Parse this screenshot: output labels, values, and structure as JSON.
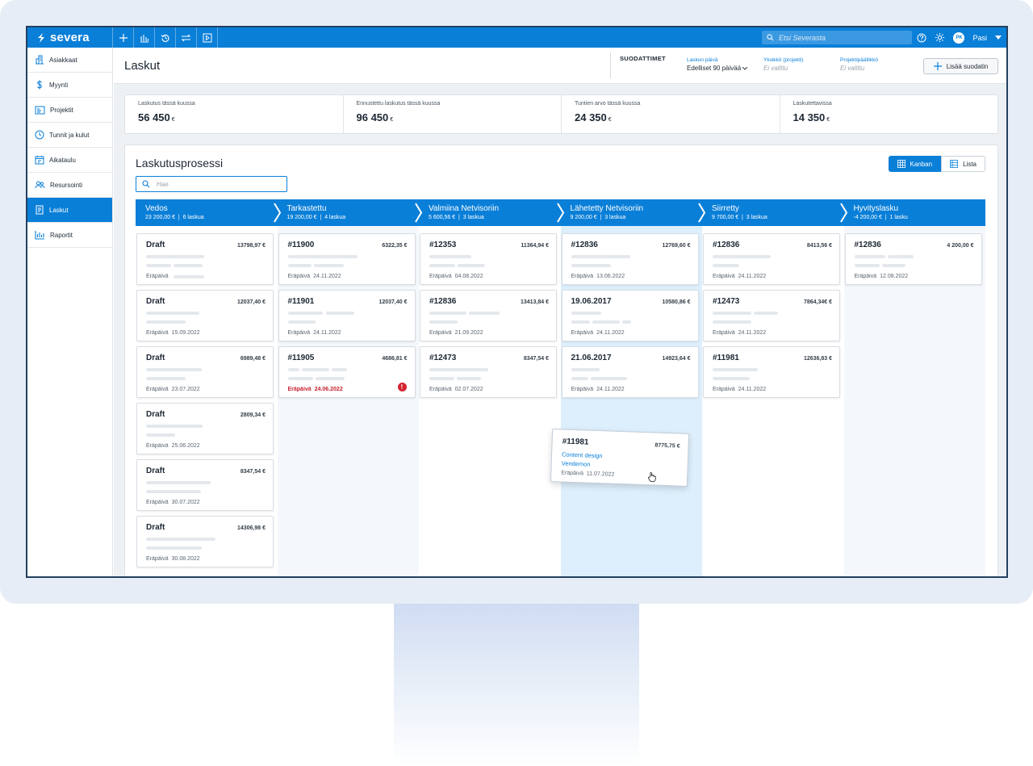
{
  "app": {
    "logo": "severa"
  },
  "topbar": {
    "icons": [
      "plus-icon",
      "bar-chart-icon",
      "history-icon",
      "swap-icon",
      "play-icon"
    ],
    "search_placeholder": "Etsi Severasta",
    "user_initials": "PK",
    "user_name": "Pasi"
  },
  "sidebar": {
    "items": [
      {
        "label": "Asiakkaat",
        "icon": "building-icon"
      },
      {
        "label": "Myynti",
        "icon": "dollar-icon"
      },
      {
        "label": "Projektit",
        "icon": "folder-icon"
      },
      {
        "label": "Tunnit ja kulut",
        "icon": "clock-icon"
      },
      {
        "label": "Aikataulu",
        "icon": "calendar-icon"
      },
      {
        "label": "Resursointi",
        "icon": "people-icon"
      },
      {
        "label": "Laskut",
        "icon": "invoice-icon",
        "active": true
      },
      {
        "label": "Raportit",
        "icon": "report-icon"
      }
    ]
  },
  "header": {
    "title": "Laskut",
    "filters_title": "SUODATTIMET",
    "filters": [
      {
        "label": "Laskun päivä",
        "value": "Edelliset 90 päivää"
      },
      {
        "label": "Yksikkö (projekti)",
        "value": "Ei valittu"
      },
      {
        "label": "Projektipäällikkö",
        "value": "Ei valittu"
      }
    ],
    "add_filter": "Lisää suodatin"
  },
  "stats": [
    {
      "label": "Laskutus tässä kuussa",
      "value": "56 450",
      "currency": "€"
    },
    {
      "label": "Ennustettu laskutus tässä kuussa",
      "value": "96 450",
      "currency": "€"
    },
    {
      "label": "Tuntien arvo tässä kuussa",
      "value": "24 350",
      "currency": "€"
    },
    {
      "label": "Laskutettavissa",
      "value": "14 350",
      "currency": "€"
    }
  ],
  "process": {
    "title": "Laskutusprosessi",
    "search_placeholder": "Hae",
    "view_kanban": "Kanban",
    "view_list": "Lista"
  },
  "due_label": "Eräpäivä",
  "columns": [
    {
      "name": "Vedos",
      "total": "23 200,00 €",
      "count": "6 laskua",
      "cards": [
        {
          "title": "Draft",
          "amount": "13798,97 €",
          "due": ""
        },
        {
          "title": "Draft",
          "amount": "12037,40 €",
          "due": "15.09.2022"
        },
        {
          "title": "Draft",
          "amount": "6989,48 €",
          "due": "23.07.2022"
        },
        {
          "title": "Draft",
          "amount": "2809,34 €",
          "due": "25.06.2022"
        },
        {
          "title": "Draft",
          "amount": "8347,54 €",
          "due": "30.07.2022"
        },
        {
          "title": "Draft",
          "amount": "14306,98 €",
          "due": "30.08.2022"
        }
      ]
    },
    {
      "name": "Tarkastettu",
      "total": "19 200,00 €",
      "count": "4 laskua",
      "cards": [
        {
          "title": "#11900",
          "amount": "6322,35 €",
          "due": "24.11.2022"
        },
        {
          "title": "#11901",
          "amount": "12037,40 €",
          "due": "24.11.2022"
        },
        {
          "title": "#11905",
          "amount": "4686,81 €",
          "due": "24.06.2022",
          "overdue": true
        }
      ]
    },
    {
      "name": "Valmiina Netvisoriin",
      "total": "5 600,56 €",
      "count": "3 laskua",
      "cards": [
        {
          "title": "#12353",
          "amount": "11364,94 €",
          "due": "04.08.2022"
        },
        {
          "title": "#12836",
          "amount": "13413,84 €",
          "due": "21.09.2022"
        },
        {
          "title": "#12473",
          "amount": "8347,54 €",
          "due": "02.07.2022"
        }
      ]
    },
    {
      "name": "Lähetetty Netvisoriin",
      "total": "9 200,00 €",
      "count": "3 laskua",
      "cards": [
        {
          "title": "#12836",
          "amount": "12769,60 €",
          "due": "13.06.2022"
        },
        {
          "title": "19.06.2017",
          "amount": "10580,86 €",
          "due": "24.11.2022"
        },
        {
          "title": "21.06.2017",
          "amount": "14923,64 €",
          "due": "24.11.2022"
        }
      ]
    },
    {
      "name": "Siirretty",
      "total": "9 700,00 €",
      "count": "3 laskua",
      "cards": [
        {
          "title": "#12836",
          "amount": "8413,56 €",
          "due": "24.11.2022"
        },
        {
          "title": "#12473",
          "amount": "7864,34€ €",
          "due": "24.11.2022"
        },
        {
          "title": "#11981",
          "amount": "12636,83 €",
          "due": "24.11.2022"
        }
      ]
    },
    {
      "name": "Hyvityslasku",
      "total": "-4 200,00 €",
      "count": "1 lasku",
      "cards": [
        {
          "title": "#12836",
          "amount": "4 200,00 €",
          "due": "12.08.2022"
        }
      ]
    }
  ],
  "dragged_card": {
    "title": "#11981",
    "amount": "8775,75 €",
    "link1": "Content design",
    "link2": "Vendemon",
    "due": "11.07.2022"
  },
  "colors": {
    "brand": "#0a7fd8",
    "overdue": "#c8202f",
    "highlight": "#ddeffc"
  }
}
